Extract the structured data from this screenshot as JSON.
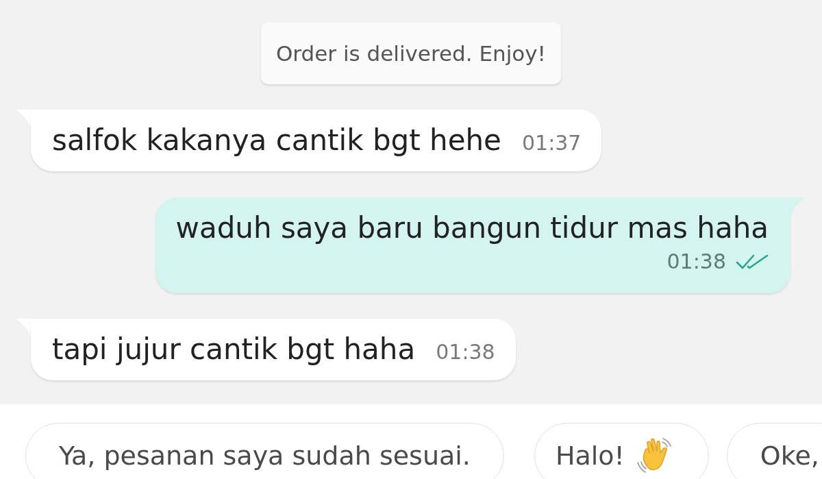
{
  "notice": {
    "text": "Order is delivered. Enjoy!"
  },
  "messages": [
    {
      "kind": "incoming",
      "text": "salfok kakanya cantik bgt hehe",
      "time": "01:37"
    },
    {
      "kind": "outgoing",
      "text": "waduh saya baru bangun tidur mas haha",
      "time": "01:38",
      "read": true
    },
    {
      "kind": "incoming",
      "text": "tapi jujur cantik bgt haha",
      "time": "01:38"
    }
  ],
  "quick_replies": [
    {
      "kind": "plain",
      "label": "Ya, pesanan saya sudah sesuai."
    },
    {
      "kind": "emoji",
      "label": "Halo!"
    },
    {
      "kind": "plain",
      "label": "Oke,"
    }
  ]
}
